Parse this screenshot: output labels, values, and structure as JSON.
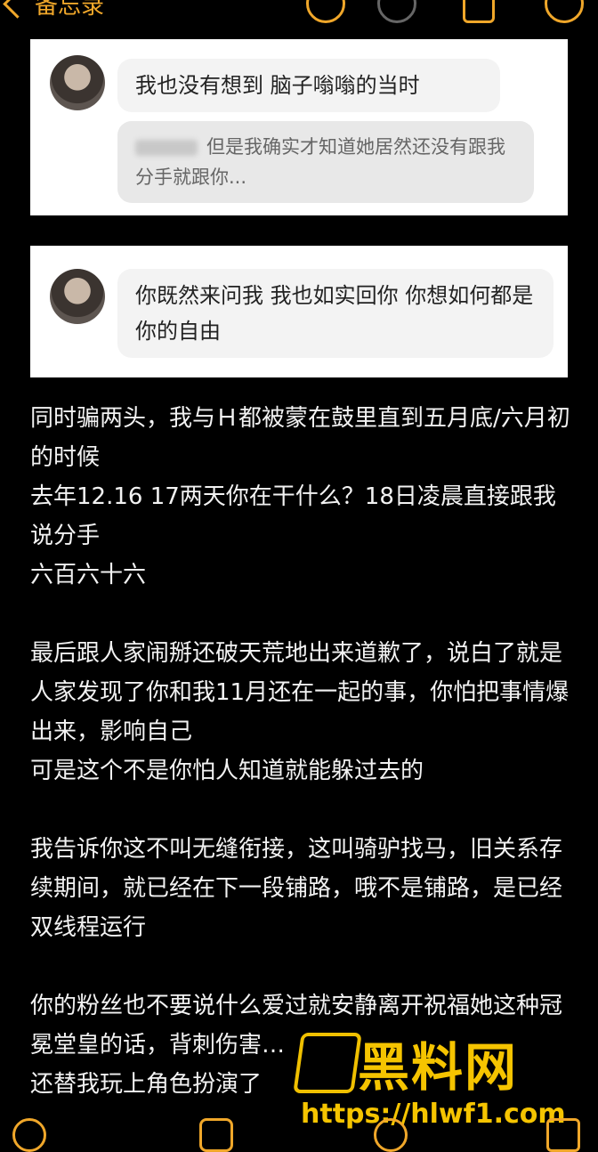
{
  "nav": {
    "back_label": "备忘录",
    "icons": [
      "undo-icon",
      "redo-icon",
      "share-icon",
      "more-icon"
    ]
  },
  "cards": [
    {
      "message": "我也没有想到 脑子嗡嗡的当时",
      "quote": "但是我确实才知道她居然还没有跟我分手就跟你..."
    },
    {
      "message": "你既然来问我 我也如实回你 你想如何都是你的自由"
    }
  ],
  "paragraphs": [
    "同时骗两头，我与Ｈ都被蒙在鼓里直到五月底/六月初的时候\n去年12.16 17两天你在干什么？18日凌晨直接跟我说分手\n六百六十六",
    "最后跟人家闹掰还破天荒地出来道歉了，说白了就是人家发现了你和我11月还在一起的事，你怕把事情爆出来，影响自己\n可是这个不是你怕人知道就能躲过去的",
    "我告诉你这不叫无缝衔接，这叫骑驴找马，旧关系存续期间，就已经在下一段铺路，哦不是铺路，是已经双线程运行",
    "你的粉丝也不要说什么爱过就安静离开祝福她这种冠冕堂皇的话，背刺伤害…\n还替我玩上角色扮演了"
  ],
  "watermark": {
    "title": "黑料网",
    "url": "https://hlwf1.com"
  },
  "bottom_icons": [
    "checklist-icon",
    "attachment-icon",
    "pen-icon",
    "compose-icon"
  ]
}
